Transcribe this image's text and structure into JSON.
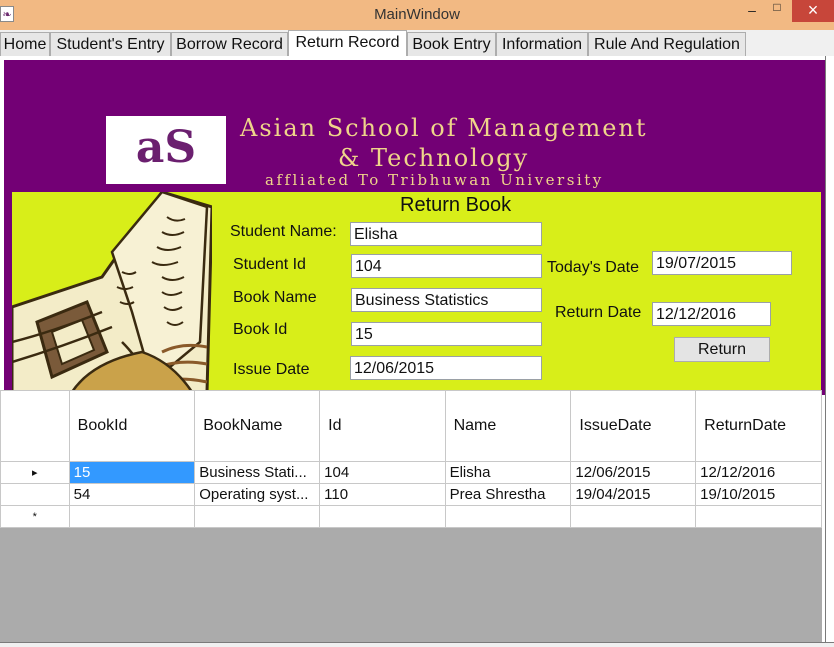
{
  "window": {
    "title": "MainWindow",
    "minimize": "–",
    "maximize": "□",
    "close": "×"
  },
  "tabs": [
    {
      "label": "Home"
    },
    {
      "label": "Student's Entry"
    },
    {
      "label": "Borrow Record"
    },
    {
      "label": "Return Record"
    },
    {
      "label": "Book Entry"
    },
    {
      "label": "Information"
    },
    {
      "label": "Rule And Regulation"
    }
  ],
  "active_tab": "Return Record",
  "banner": {
    "logo_text": "aS",
    "line1": "Asian School of Management",
    "line2": "& Technology",
    "line3": "affliated To Tribhuwan University"
  },
  "form": {
    "title": "Return Book",
    "student_name_label": "Student Name:",
    "student_name_value": "Elisha",
    "student_id_label": "Student Id",
    "student_id_value": "104",
    "book_name_label": "Book Name",
    "book_name_value": "Business Statistics",
    "book_id_label": "Book Id",
    "book_id_value": "15",
    "issue_date_label": "Issue Date",
    "issue_date_value": "12/06/2015",
    "todays_date_label": "Today's Date",
    "todays_date_value": "19/07/2015",
    "return_date_label": "Return Date",
    "return_date_value": "12/12/2016",
    "return_button": "Return"
  },
  "grid": {
    "columns": [
      "BookId",
      "BookName",
      "Id",
      "Name",
      "IssueDate",
      "ReturnDate"
    ],
    "rows": [
      {
        "marker": "▸",
        "cells": [
          "15",
          "Business Stati...",
          "104",
          "Elisha",
          "12/06/2015",
          "12/12/2016"
        ]
      },
      {
        "marker": "",
        "cells": [
          "54",
          "Operating syst...",
          "110",
          "Prea Shrestha",
          "19/04/2015",
          "19/10/2015"
        ]
      }
    ],
    "new_row_marker": "*"
  }
}
